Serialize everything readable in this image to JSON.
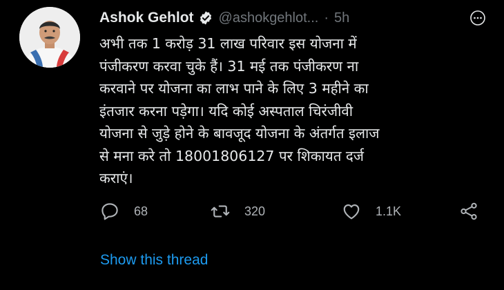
{
  "tweet": {
    "author_name": "Ashok Gehlot",
    "handle": "@ashokgehlot...",
    "separator": "·",
    "time": "5h",
    "text": "अभी तक 1 करोड़ 31 लाख परिवार इस योजना में\nपंजीकरण करवा चुके हैं। 31 मई तक पंजीकरण ना\nकरवाने पर योजना का लाभ पाने के लिए 3 महीने का\nइंतजार करना पड़ेगा। यदि कोई अस्पताल चिरंजीवी\nयोजना से जुड़े होने के बावजूद योजना के अंतर्गत इलाज\nसे मना करे तो 18001806127 पर शिकायत दर्ज\nकराएं।",
    "replies": "68",
    "retweets": "320",
    "likes": "1.1K",
    "show_thread": "Show this thread"
  },
  "colors": {
    "background": "#000000",
    "text": "#e7e9ea",
    "muted": "#71767b",
    "link": "#1d9bf0"
  },
  "icons": [
    "verified-badge-icon",
    "more-options-icon",
    "reply-icon",
    "retweet-icon",
    "like-icon",
    "share-icon"
  ]
}
